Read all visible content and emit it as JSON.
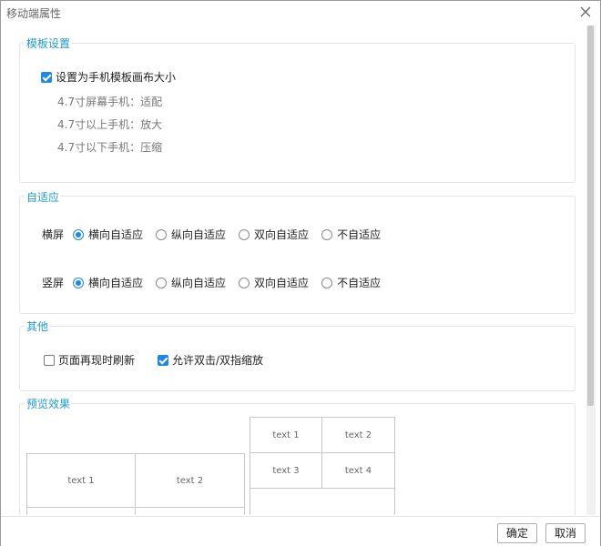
{
  "window": {
    "title": "移动端属性"
  },
  "template": {
    "section_title": "模板设置",
    "checkbox_label": "设置为手机模板画布大小",
    "hints": [
      "4.7寸屏幕手机：适配",
      "4.7寸以上手机：放大",
      "4.7寸以下手机：压缩"
    ]
  },
  "adaptive": {
    "section_title": "自适应",
    "landscape_label": "横屏",
    "portrait_label": "竖屏",
    "options": [
      "横向自适应",
      "纵向自适应",
      "双向自适应",
      "不自适应"
    ],
    "landscape_selected": "横向自适应",
    "portrait_selected": "横向自适应"
  },
  "other": {
    "section_title": "其他",
    "refresh_label": "页面再现时刷新",
    "zoom_label": "允许双击/双指缩放",
    "refresh_checked": false,
    "zoom_checked": true
  },
  "preview": {
    "section_title": "预览效果",
    "left_cells": [
      "text 1",
      "text 2"
    ],
    "right_cells": [
      "text 1",
      "text 2",
      "text 3",
      "text 4"
    ]
  },
  "footer": {
    "ok_label": "确定",
    "cancel_label": "取消"
  }
}
